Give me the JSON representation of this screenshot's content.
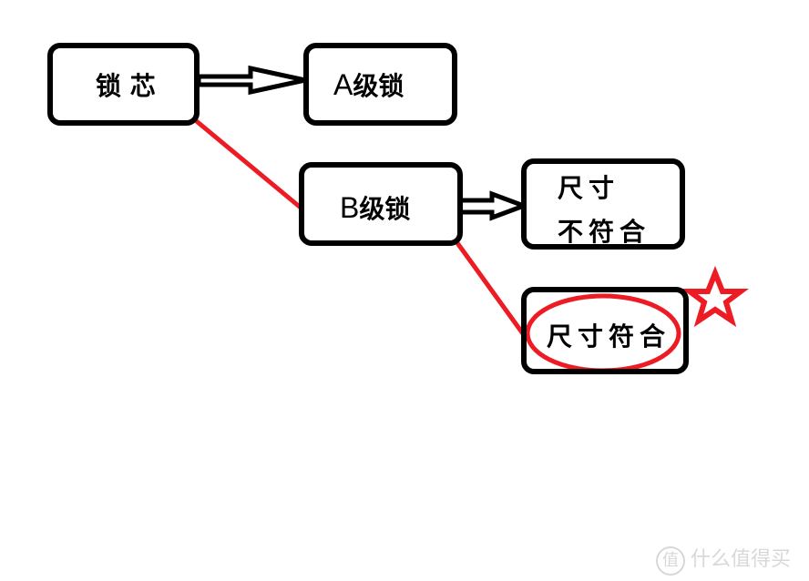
{
  "nodes": {
    "root": {
      "text": "锁 芯"
    },
    "a_grade": {
      "prefix": "A",
      "text": "级锁"
    },
    "b_grade": {
      "prefix": "B",
      "text": "级锁"
    },
    "size_mismatch": {
      "line1": "尺寸",
      "line2": "不符合"
    },
    "size_match": {
      "text": "尺寸符合"
    }
  },
  "edges": [
    {
      "from": "root",
      "to": "a_grade",
      "style": "double-arrow",
      "color": "#000000"
    },
    {
      "from": "root",
      "to": "b_grade",
      "style": "line",
      "color": "#ed1c24"
    },
    {
      "from": "b_grade",
      "to": "size_mismatch",
      "style": "double-arrow",
      "color": "#000000"
    },
    {
      "from": "b_grade",
      "to": "size_match",
      "style": "line",
      "color": "#ed1c24"
    }
  ],
  "highlight": {
    "target": "size_match",
    "marker": "star-icon",
    "color": "#ed1c24"
  },
  "watermark": {
    "badge": "值",
    "text": "什么值得买"
  }
}
